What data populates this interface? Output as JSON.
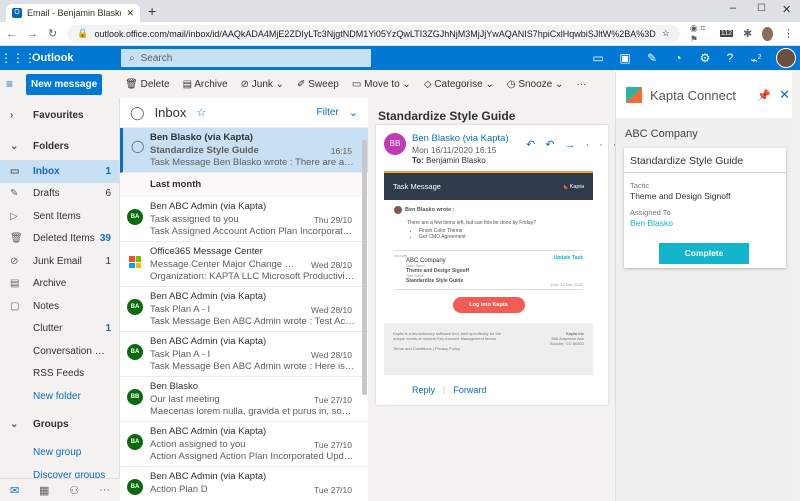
{
  "browser": {
    "tab_title": "Email - Benjamin Blasko - Outlook",
    "url": "outlook.office.com/mail/inbox/id/AAQkADA4MjE2ZDIyLTc3NjgtNDM1Yi05YzQwLTI3ZGJhNjM3MjJjYwAQANIS7hpiCxlHqwbiSJltW%2BA%3D",
    "ext_badge": "112"
  },
  "header": {
    "app": "Outlook",
    "search_placeholder": "Search",
    "notif_count": "2"
  },
  "toolbar": {
    "new_message": "New message",
    "delete": "Delete",
    "archive": "Archive",
    "junk": "Junk",
    "sweep": "Sweep",
    "move_to": "Move to",
    "categorise": "Categorise",
    "snooze": "Snooze"
  },
  "nav": {
    "favourites": "Favourites",
    "folders": "Folders",
    "groups": "Groups",
    "items": [
      {
        "label": "Inbox",
        "count": "1",
        "icon": "inbox"
      },
      {
        "label": "Drafts",
        "count": "6",
        "icon": "pencil"
      },
      {
        "label": "Sent Items",
        "count": "",
        "icon": "send"
      },
      {
        "label": "Deleted Items",
        "count": "39",
        "icon": "trash"
      },
      {
        "label": "Junk Email",
        "count": "1",
        "icon": "block"
      },
      {
        "label": "Archive",
        "count": "",
        "icon": "archive"
      },
      {
        "label": "Notes",
        "count": "",
        "icon": "note"
      },
      {
        "label": "Clutter",
        "count": "1",
        "icon": ""
      },
      {
        "label": "Conversation History",
        "count": "",
        "icon": ""
      },
      {
        "label": "RSS Feeds",
        "count": "",
        "icon": ""
      }
    ],
    "new_folder": "New folder",
    "new_group": "New group",
    "discover_groups": "Discover groups"
  },
  "list": {
    "title": "Inbox",
    "filter": "Filter",
    "group_label": "Last month",
    "selected": {
      "from": "Ben Blasko (via Kapta)",
      "subject": "Standardize Style Guide",
      "time": "16:15",
      "preview": "Task Message Ben Blasko wrote : There are a few items left, but can this be done by Friday?"
    },
    "messages": [
      {
        "from": "Ben ABC Admin (via Kapta)",
        "initials": "BA",
        "subject": "Task assigned to you",
        "date": "Thu 29/10",
        "preview": "Task Assigned Account Action Plan Incorporated Action Plan"
      },
      {
        "from": "Office365 Message Center",
        "initials": "",
        "subject": "Message Center Major Change Update Notification",
        "date": "Wed 28/10",
        "preview": "Organization: KAPTA LLC Microsoft Productivity Score solution"
      },
      {
        "from": "Ben ABC Admin (via Kapta)",
        "initials": "BA",
        "subject": "Task Plan A - I",
        "date": "Wed 28/10",
        "preview": "Task Message Ben ABC Admin wrote : Test Account Action"
      },
      {
        "from": "Ben ABC Admin (via Kapta)",
        "initials": "BA",
        "subject": "Task Plan A - I",
        "date": "Wed 28/10",
        "preview": "Task Message Ben ABC Admin wrote : Here is a task that needs doing"
      },
      {
        "from": "Ben Blasko",
        "initials": "BB",
        "subject": "Our last meeting",
        "date": "Tue 27/10",
        "preview": "Maecenas lorem nulla, gravida et purus in, sodales mattis"
      },
      {
        "from": "Ben ABC Admin (via Kapta)",
        "initials": "BA",
        "subject": "Action assigned to you",
        "date": "Tue 27/10",
        "preview": "Action Assigned Action Plan Incorporated Update Action"
      },
      {
        "from": "Ben ABC Admin (via Kapta)",
        "initials": "BA",
        "subject": "Action Plan D",
        "date": "Tue 27/10",
        "preview": ""
      }
    ]
  },
  "reading": {
    "subject": "Standardize Style Guide",
    "initials": "BB",
    "from": "Ben Blasko (via Kapta)",
    "date": "Mon 16/11/2020 16:15",
    "to_label": "To:",
    "to": "Benjamin Blasko",
    "reply": "Reply",
    "forward": "Forward",
    "email": {
      "banner": "Task Message",
      "brand": "Kapta",
      "wrote": "Ben Blasko wrote :",
      "body": "There are a few items left, but can this be done by Friday?",
      "bullets": [
        "Finish Color Theme",
        "Get CMO Agreement"
      ],
      "account_label": "Account",
      "account": "ABC Company",
      "update_task": "Update Task",
      "tactic_label": "Tactic Name",
      "tactic": "Theme and Design Signoff",
      "task_label": "Task Name",
      "task": "Standardize Style Guide",
      "due": "Due: 31 Dec 2020",
      "login": "Log into Kapta",
      "footer_text": "Kapta is a revolutionary software tool, built specifically for the unique needs of modern Key Account Management teams.",
      "footer_links": "Terms and Conditions | Privacy Policy",
      "addr1": "Kapta Inc",
      "addr2": "885 Arapahoe Ave",
      "addr3": "Boulder, CO 80302"
    }
  },
  "kapta": {
    "title": "Kapta Connect",
    "company": "ABC Company",
    "task": "Standardize Style Guide",
    "tactic_label": "Tactic",
    "tactic": "Theme and Design Signoff",
    "assigned_label": "Assigned To",
    "assigned": "Ben Blasko",
    "complete": "Complete"
  },
  "colors": {
    "brand": "#0078d4",
    "selected": "#c7e0f4",
    "avatar_green": "#0b6a0b",
    "avatar_purple": "#c239b3",
    "kapta_teal": "#12b5cb",
    "login": "#f25c54"
  }
}
